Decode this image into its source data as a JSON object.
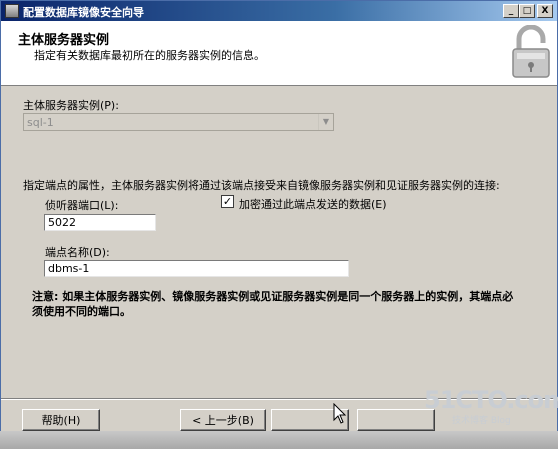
{
  "window": {
    "title": "配置数据库镜像安全向导",
    "controls": {
      "minimize": "_",
      "maximize": "□",
      "close": "X"
    }
  },
  "header": {
    "title": "主体服务器实例",
    "description": "指定有关数据库最初所在的服务器实例的信息。",
    "icon": "lock-icon"
  },
  "principal_server": {
    "label": "主体服务器实例(P):",
    "value": "sql-1"
  },
  "endpoint": {
    "intro": "指定端点的属性，主体服务器实例将通过该端点接受来自镜像服务器实例和见证服务器实例的连接:",
    "port_label": "侦听器端口(L):",
    "port_value": "5022",
    "encrypt_label": "加密通过此端点发送的数据(E)",
    "encrypt_checked": true,
    "name_label": "端点名称(D):",
    "name_value": "dbms-1"
  },
  "note": "注意: 如果主体服务器实例、镜像服务器实例或见证服务器实例是同一个服务器上的实例，其端点必须使用不同的端口。",
  "footer": {
    "help_label": "帮助(H)",
    "back_label": "< 上一步(B)"
  },
  "watermark": {
    "main": "51CTO.com",
    "sub": "技术博客 Blog"
  },
  "colors": {
    "titlebar_start": "#0a246a",
    "titlebar_end": "#a6caf0",
    "dialog_face": "#d4d0c8"
  }
}
